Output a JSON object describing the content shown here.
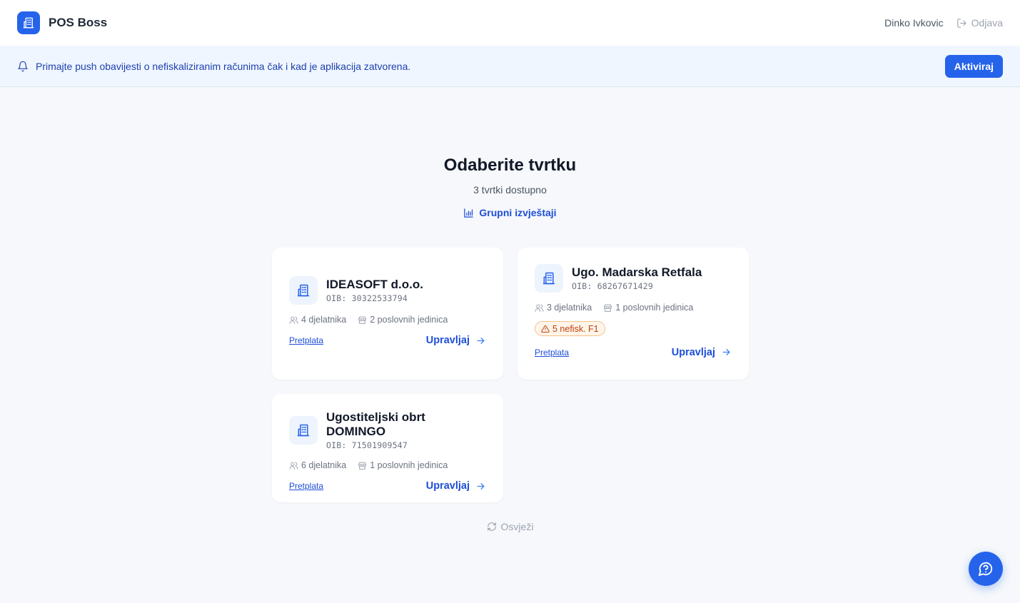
{
  "header": {
    "app_name": "POS Boss",
    "user_name": "Dinko Ivkovic",
    "logout_label": "Odjava"
  },
  "notice": {
    "text": "Primajte push obavijesti o nefiskaliziranim računima čak i kad je aplikacija zatvorena.",
    "button_label": "Aktiviraj"
  },
  "main": {
    "title": "Odaberite tvrtku",
    "subtitle": "3 tvrtki dostupno",
    "group_reports_label": "Grupni izvještaji",
    "refresh_label": "Osvježi"
  },
  "companies": [
    {
      "name": "IDEASOFT d.o.o.",
      "oib": "OIB: 30322533794",
      "employees": "4 djelatnika",
      "units": "2 poslovnih jedinica",
      "subscription_label": "Pretplata",
      "manage_label": "Upravljaj"
    },
    {
      "name": "Ugo. Madarska Retfala",
      "oib": "OIB: 68267671429",
      "employees": "3 djelatnika",
      "units": "1 poslovnih jedinica",
      "warning": "5 nefisk. F1",
      "subscription_label": "Pretplata",
      "manage_label": "Upravljaj"
    },
    {
      "name": "Ugostiteljski obrt DOMINGO",
      "oib": "OIB: 71501909547",
      "employees": "6 djelatnika",
      "units": "1 poslovnih jedinica",
      "subscription_label": "Pretplata",
      "manage_label": "Upravljaj"
    }
  ],
  "colors": {
    "accent": "#2563eb",
    "link": "#1d4ed8",
    "warning_text": "#c2410c",
    "warning_bg": "#fff5ea",
    "background": "#f6f8fb"
  }
}
